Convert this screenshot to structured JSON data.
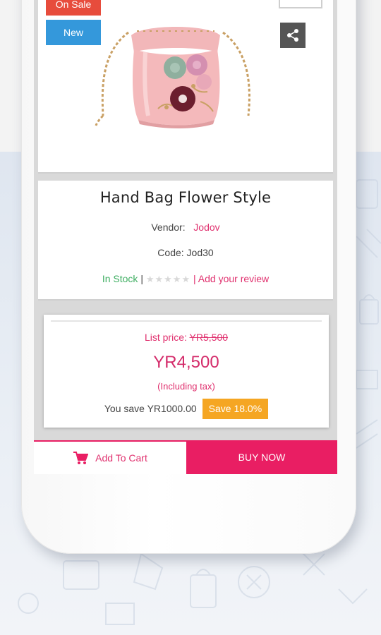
{
  "badges": {
    "sale": "On Sale",
    "new": "New"
  },
  "icons": {
    "share": "share-icon",
    "cart": "cart-icon",
    "wishlist": "wishlist-box"
  },
  "product": {
    "title": "Hand Bag Flower Style",
    "vendor_label": "Vendor:",
    "vendor": "Jodov",
    "code": "Code: Jod30",
    "stock": "In Stock",
    "separator_left": "|",
    "rating_stars": "★★★★★",
    "rating_value": 0,
    "review_link": "| Add your review"
  },
  "pricing": {
    "list_price_label": "List price:",
    "list_price": "YR5,500",
    "price": "YR4,500",
    "tax_note": "(Including tax)",
    "you_save": "You save YR1000.00",
    "save_badge": "Save 18.0%"
  },
  "actions": {
    "add_to_cart": "Add To Cart",
    "buy_now": "BUY NOW"
  },
  "colors": {
    "accent": "#e91e63",
    "sale_badge": "#e74c3c",
    "new_badge": "#3498db",
    "save_badge": "#f5a623",
    "in_stock": "#3fae62"
  }
}
